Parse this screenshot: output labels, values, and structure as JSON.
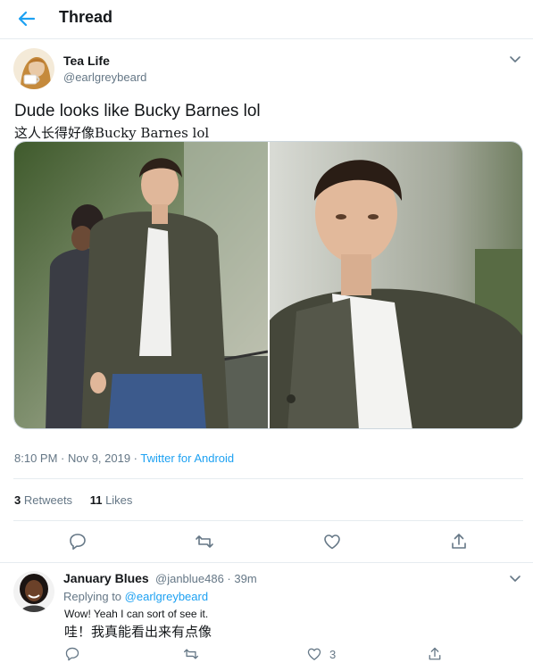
{
  "header": {
    "title": "Thread"
  },
  "tweet": {
    "author_name": "Tea Life",
    "author_handle": "@earlgreybeard",
    "text_en": "Dude looks like Bucky Barnes lol",
    "text_zh": "这人长得好像Bucky Barnes lol",
    "time": "8:10 PM · Nov 9, 2019 · ",
    "source": "Twitter for Android",
    "retweets_count": "3",
    "retweets_label": "Retweets",
    "likes_count": "11",
    "likes_label": "Likes"
  },
  "reply": {
    "author_name": "January Blues",
    "author_handle": "@janblue486 · 39m",
    "replying_prefix": "Replying to ",
    "replying_to": "@earlgreybeard",
    "text_en": "Wow! Yeah I can sort of see it.",
    "text_zh": "哇！我真能看出来有点像",
    "likes_count": "3"
  },
  "colors": {
    "accent": "#1da1f2",
    "secondary_text": "#657786",
    "border": "#e6ecf0"
  },
  "icons": [
    "back-arrow-icon",
    "chevron-down-icon",
    "reply-icon",
    "retweet-icon",
    "like-icon",
    "share-icon"
  ]
}
